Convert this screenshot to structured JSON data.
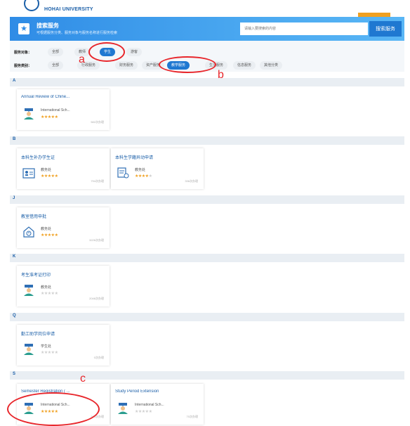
{
  "header": {
    "university": "HOHAI UNIVERSITY"
  },
  "search": {
    "title": "搜索服务",
    "subtitle": "可根据服务分类、服务对象与服务名称进行服务检索",
    "placeholder": "请输入要搜索的内容",
    "button": "搜索服务"
  },
  "filters": {
    "audience_label": "服务对象：",
    "audience": [
      "全部",
      "教师",
      "学生",
      "游客"
    ],
    "audience_active": "学生",
    "category_label": "服务类别：",
    "category": [
      "全部",
      "行政服务",
      "财务服务",
      "资产服务",
      "教学服务",
      "生活服务",
      "信息服务",
      "其他分类"
    ],
    "category_active": "教学服务"
  },
  "annotations": [
    "a",
    "b",
    "c"
  ],
  "sections": [
    {
      "letter": "A",
      "cards": [
        {
          "title": "Annual Review of Chine...",
          "dept": "International Sch...",
          "rating": 5,
          "views": "582次办理",
          "icon": "graduate-icon"
        }
      ]
    },
    {
      "letter": "B",
      "cards": [
        {
          "title": "本科生补办学生证",
          "dept": "教务处",
          "rating": 5,
          "views": "794次办理",
          "icon": "id-card-icon"
        },
        {
          "title": "本科生学籍异动申请",
          "dept": "教务处",
          "rating": 4,
          "views": "336次办理",
          "icon": "student-status-icon"
        }
      ]
    },
    {
      "letter": "J",
      "cards": [
        {
          "title": "教室借用申批",
          "dept": "教务处",
          "rating": 5,
          "views": "3226次办理",
          "icon": "classroom-icon"
        }
      ]
    },
    {
      "letter": "K",
      "cards": [
        {
          "title": "考生准考证打印",
          "dept": "教务处",
          "rating": 0,
          "views": "2046次办理",
          "icon": "graduate-icon"
        }
      ]
    },
    {
      "letter": "Q",
      "cards": [
        {
          "title": "勤工助学岗位申请",
          "dept": "学生处",
          "rating": 0,
          "views": "0次办理",
          "icon": "graduate-icon"
        }
      ]
    },
    {
      "letter": "S",
      "cards": [
        {
          "title": "Semester Registration ( ...",
          "dept": "International Sch...",
          "rating": 5,
          "views": "340次办理",
          "icon": "graduate-icon"
        },
        {
          "title": "Study Period Extension",
          "dept": "International Sch...",
          "rating": 0,
          "views": "70次办理",
          "icon": "graduate-icon"
        }
      ]
    }
  ]
}
